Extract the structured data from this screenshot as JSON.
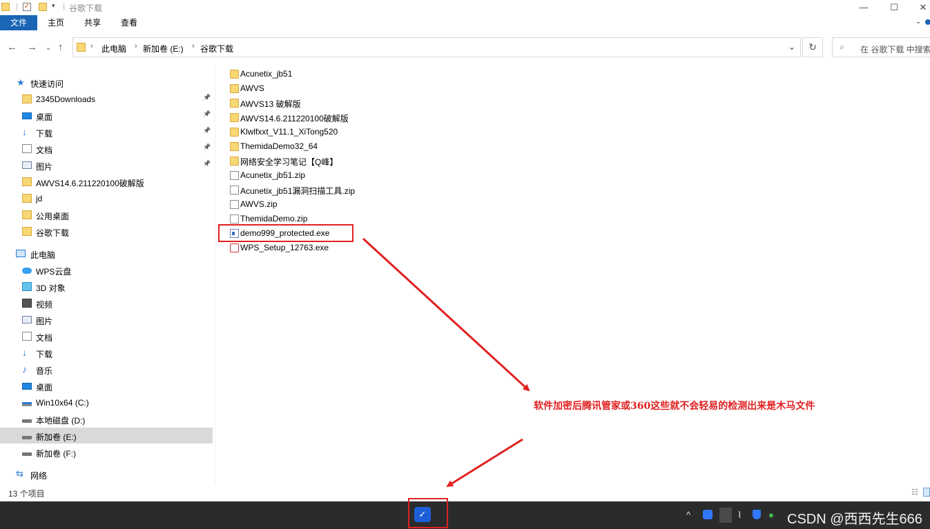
{
  "window": {
    "title": "谷歌下载",
    "controls": {
      "minimize": "—",
      "maximize": "☐",
      "close": "✕"
    }
  },
  "ribbon": {
    "tabs": [
      "文件",
      "主页",
      "共享",
      "查看"
    ]
  },
  "address": {
    "crumbs": [
      "此电脑",
      "新加卷 (E:)",
      "谷歌下载"
    ],
    "search_placeholder": "在 谷歌下载 中搜索"
  },
  "sidebar": {
    "quick_access": "快速访问",
    "quick_items": [
      {
        "label": "2345Downloads",
        "icon": "folder-icon",
        "pinned": true
      },
      {
        "label": "桌面",
        "icon": "desktop-icon",
        "pinned": true
      },
      {
        "label": "下载",
        "icon": "download-icon",
        "pinned": true
      },
      {
        "label": "文档",
        "icon": "document-icon",
        "pinned": true
      },
      {
        "label": "图片",
        "icon": "picture-icon",
        "pinned": true
      },
      {
        "label": "AWVS14.6.211220100破解版",
        "icon": "folder-icon",
        "pinned": false
      },
      {
        "label": "jd",
        "icon": "folder-icon",
        "pinned": false
      },
      {
        "label": "公用桌面",
        "icon": "folder-icon",
        "pinned": false
      },
      {
        "label": "谷歌下载",
        "icon": "folder-icon",
        "pinned": false
      }
    ],
    "this_pc": "此电脑",
    "pc_items": [
      {
        "label": "WPS云盘",
        "icon": "cloud-icon"
      },
      {
        "label": "3D 对象",
        "icon": "3d-objects-icon"
      },
      {
        "label": "视频",
        "icon": "video-icon"
      },
      {
        "label": "图片",
        "icon": "picture-icon"
      },
      {
        "label": "文档",
        "icon": "document-icon"
      },
      {
        "label": "下载",
        "icon": "download-icon"
      },
      {
        "label": "音乐",
        "icon": "music-icon"
      },
      {
        "label": "桌面",
        "icon": "desktop-icon"
      },
      {
        "label": "Win10x64 (C:)",
        "icon": "system-drive-icon"
      },
      {
        "label": "本地磁盘 (D:)",
        "icon": "drive-icon"
      },
      {
        "label": "新加卷 (E:)",
        "icon": "drive-icon",
        "selected": true
      },
      {
        "label": "新加卷 (F:)",
        "icon": "drive-icon"
      }
    ],
    "network": "网络"
  },
  "files": [
    {
      "name": "Acunetix_jb51",
      "type": "folder"
    },
    {
      "name": "AWVS",
      "type": "folder"
    },
    {
      "name": "AWVS13 破解版",
      "type": "folder"
    },
    {
      "name": "AWVS14.6.211220100破解版",
      "type": "folder"
    },
    {
      "name": "Klwlfxxt_V11.1_XiTong520",
      "type": "folder"
    },
    {
      "name": "ThemidaDemo32_64",
      "type": "folder"
    },
    {
      "name": "网络安全学习笔记【Q峰】",
      "type": "folder"
    },
    {
      "name": "Acunetix_jb51.zip",
      "type": "zip"
    },
    {
      "name": "Acunetix_jb51漏洞扫描工具.zip",
      "type": "zip"
    },
    {
      "name": "AWVS.zip",
      "type": "zip"
    },
    {
      "name": "ThemidaDemo.zip",
      "type": "zip"
    },
    {
      "name": "demo999_protected.exe",
      "type": "exe",
      "highlighted": true
    },
    {
      "name": "WPS_Setup_12763.exe",
      "type": "installer"
    }
  ],
  "annotation": "软件加密后腾讯管家或360这些就不会轻易的检测出来是木马文件",
  "status": {
    "count": "13 个项目"
  },
  "taskbar": {
    "watermark": "CSDN @西西先生666"
  },
  "colors": {
    "accent": "#1a65b5",
    "annotation": "#e02020",
    "folder": "#f8d775"
  }
}
